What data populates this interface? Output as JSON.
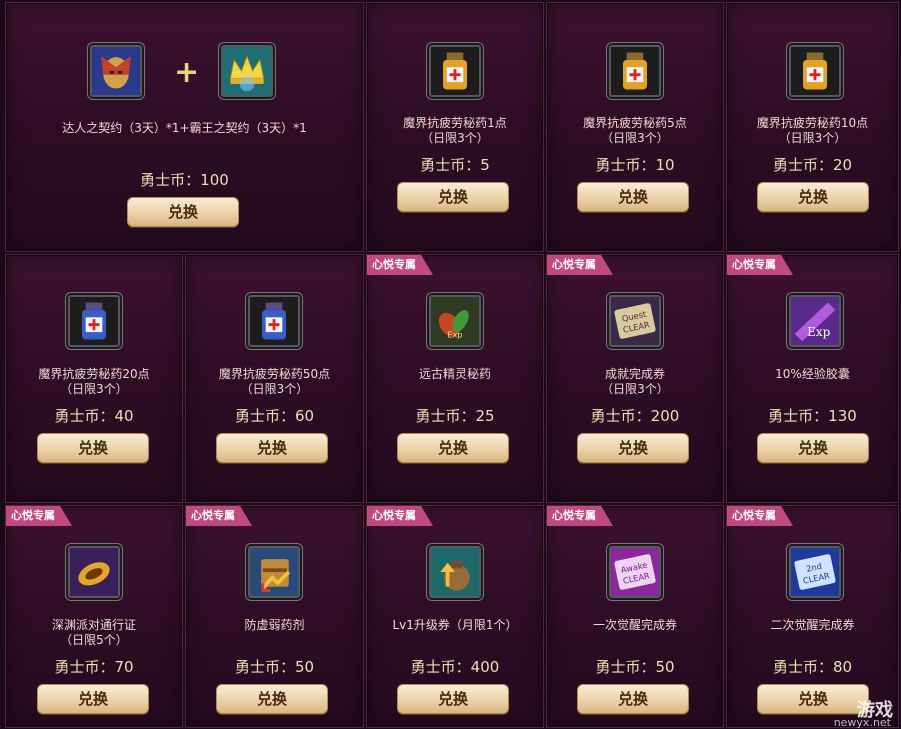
{
  "currency_label": "勇士币：",
  "exchange_label": "兑换",
  "exclusive_badge": "心悦专属",
  "watermark": {
    "text": "游戏",
    "sub": "newyx.net"
  },
  "items": [
    {
      "name": "达人之契约（3天）*1+霸王之契约（3天）*1",
      "limit": "",
      "price": "勇士币：100",
      "exclusive": false
    },
    {
      "name": "魔界抗疲劳秘药1点",
      "limit": "（日限3个）",
      "price": "勇士币：5",
      "exclusive": false
    },
    {
      "name": "魔界抗疲劳秘药5点",
      "limit": "（日限3个）",
      "price": "勇士币：10",
      "exclusive": false
    },
    {
      "name": "魔界抗疲劳秘药10点",
      "limit": "（日限3个）",
      "price": "勇士币：20",
      "exclusive": false
    },
    {
      "name": "魔界抗疲劳秘药20点",
      "limit": "（日限3个）",
      "price": "勇士币：40",
      "exclusive": false
    },
    {
      "name": "魔界抗疲劳秘药50点",
      "limit": "（日限3个）",
      "price": "勇士币：60",
      "exclusive": false
    },
    {
      "name": "远古精灵秘药",
      "limit": "",
      "price": "勇士币：25",
      "exclusive": true
    },
    {
      "name": "成就完成券",
      "limit": "（日限3个）",
      "price": "勇士币：200",
      "exclusive": true
    },
    {
      "name": "10%经验胶囊",
      "limit": "",
      "price": "勇士币：130",
      "exclusive": true
    },
    {
      "name": "深渊派对通行证",
      "limit": "（日限5个）",
      "price": "勇士币：70",
      "exclusive": true
    },
    {
      "name": "防虚弱药剂",
      "limit": "",
      "price": "勇士币：50",
      "exclusive": true
    },
    {
      "name": "Lv1升级券（月限1个）",
      "limit": "",
      "price": "勇士币：400",
      "exclusive": true
    },
    {
      "name": "一次觉醒完成券",
      "limit": "",
      "price": "勇士币：50",
      "exclusive": true
    },
    {
      "name": "二次觉醒完成券",
      "limit": "",
      "price": "勇士币：80",
      "exclusive": true
    }
  ]
}
